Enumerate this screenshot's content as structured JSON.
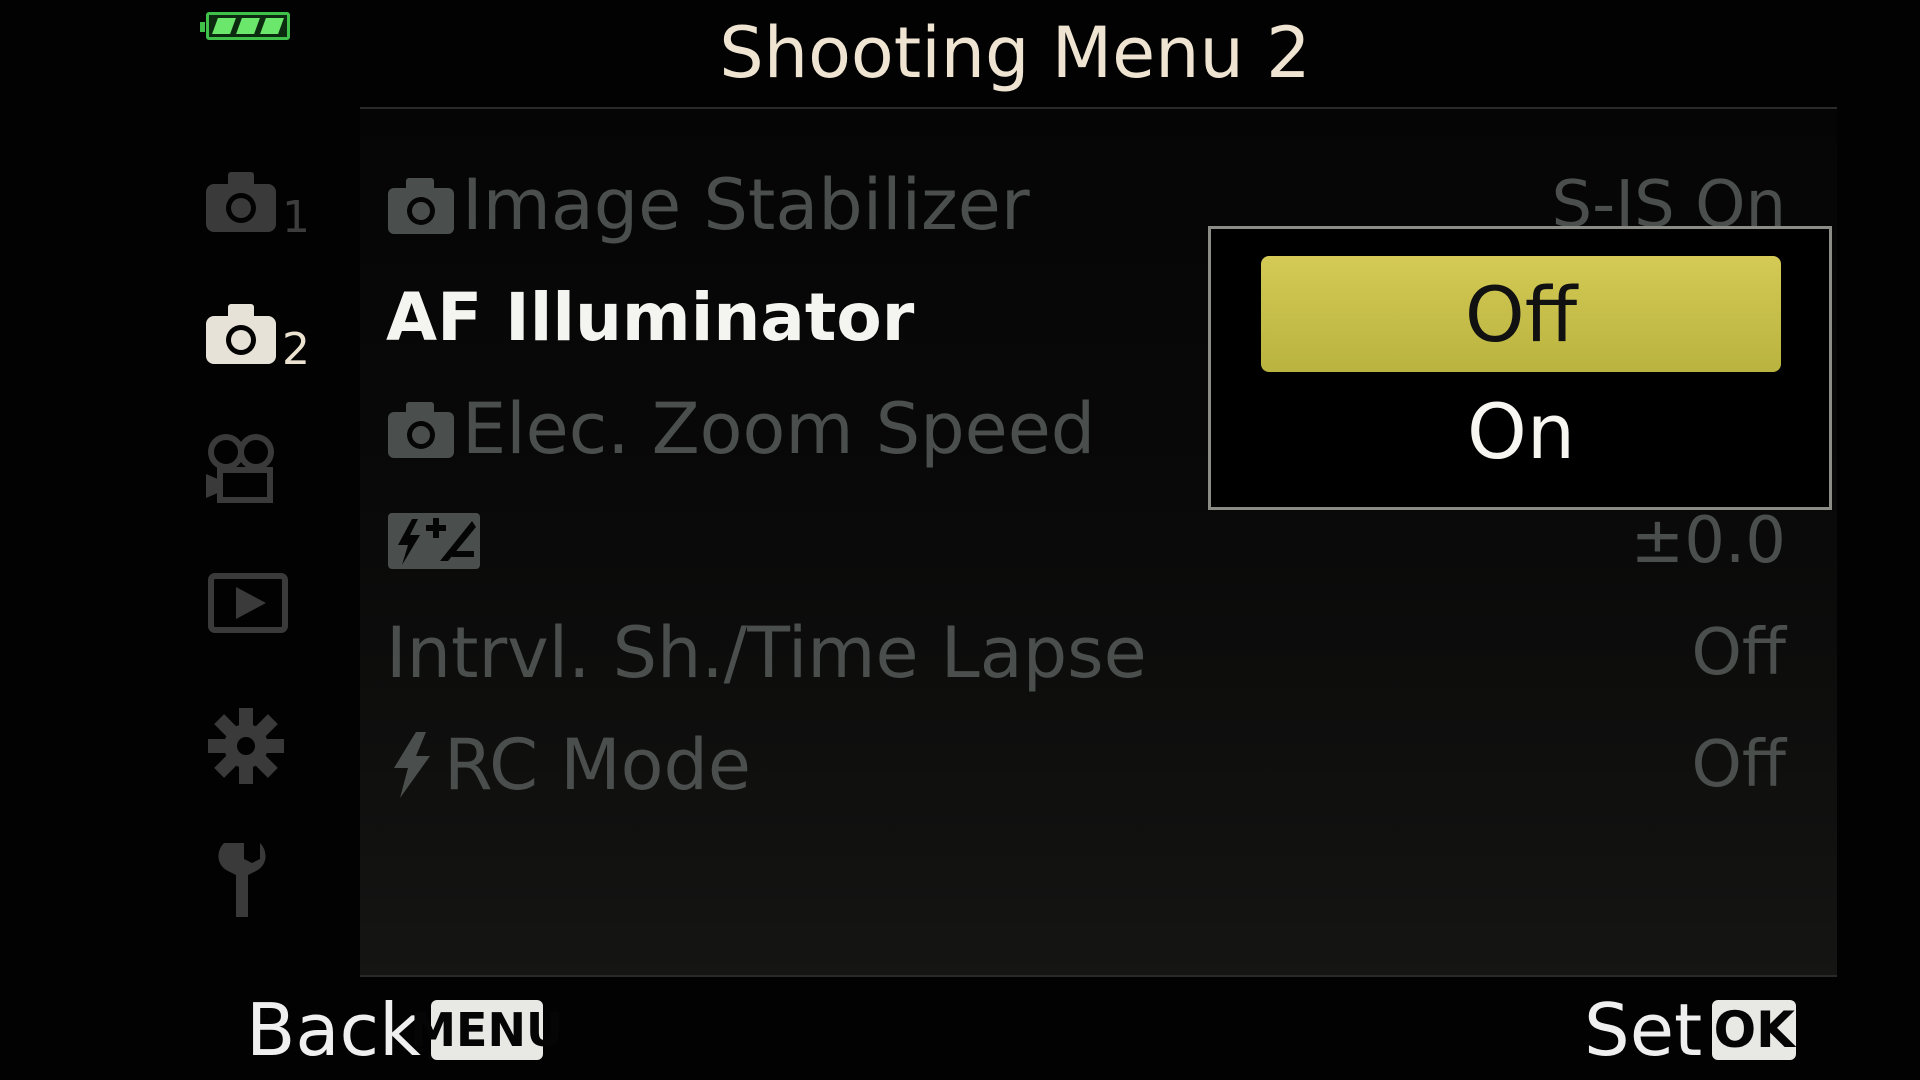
{
  "header": {
    "title": "Shooting Menu 2",
    "battery_icon": "battery-full-icon"
  },
  "sidebar": {
    "items": [
      {
        "icon": "camera-icon",
        "number": "1",
        "active": false
      },
      {
        "icon": "camera-icon",
        "number": "2",
        "active": true
      },
      {
        "icon": "movie-camera-icon",
        "number": "",
        "active": false
      },
      {
        "icon": "playback-icon",
        "number": "",
        "active": false
      },
      {
        "icon": "gear-icon",
        "number": "",
        "active": false
      },
      {
        "icon": "wrench-icon",
        "number": "",
        "active": false
      }
    ]
  },
  "menu": {
    "rows": [
      {
        "icon": "camera-small-icon",
        "label": "Image Stabilizer",
        "value": "S-IS On"
      },
      {
        "icon": "",
        "label": "AF Illuminator",
        "value": ""
      },
      {
        "icon": "camera-small-icon",
        "label": "Elec. Zoom Speed",
        "value": ""
      },
      {
        "icon": "flash-compensation-icon",
        "label": "",
        "value": "±0.0"
      },
      {
        "icon": "",
        "label": "Intrvl. Sh./Time Lapse",
        "value": "Off"
      },
      {
        "icon": "flash-icon",
        "label": "RC Mode",
        "value": "Off"
      }
    ]
  },
  "popup": {
    "options": [
      "Off",
      "On"
    ],
    "selected": "Off"
  },
  "footer": {
    "back_label": "Back",
    "back_key": "MENU",
    "set_label": "Set",
    "set_key": "OK"
  },
  "colors": {
    "highlight": "#c9c14c",
    "dim_text": "#4a4f4e",
    "title_text": "#efe4d1"
  }
}
